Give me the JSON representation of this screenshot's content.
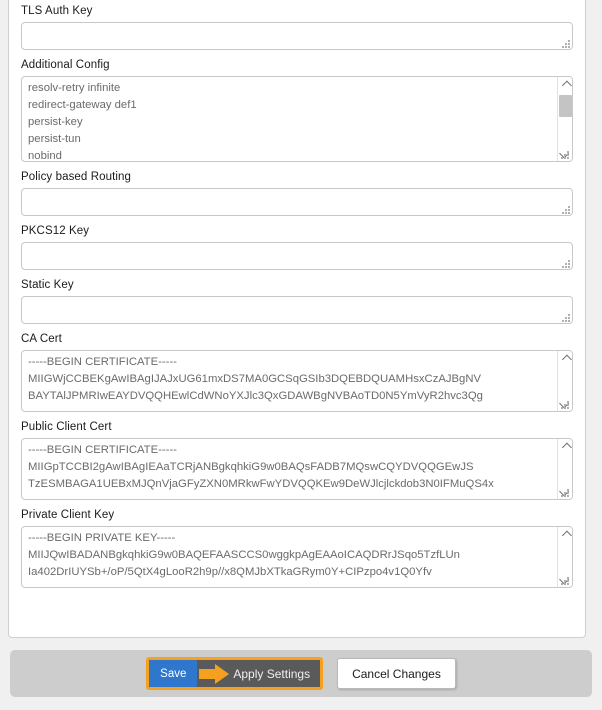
{
  "form": {
    "fields": [
      {
        "id": "tls-auth-key",
        "label": "TLS Auth Key",
        "type": "input",
        "value": "",
        "placeholder": ""
      },
      {
        "id": "additional-config",
        "label": "Additional Config",
        "type": "textarea",
        "value": "resolv-retry infinite\nredirect-gateway def1\npersist-key\npersist-tun\nnobind",
        "scrollbar": true
      },
      {
        "id": "policy-based-routing",
        "label": "Policy based Routing",
        "type": "input",
        "value": "",
        "placeholder": ""
      },
      {
        "id": "pkcs12-key",
        "label": "PKCS12 Key",
        "type": "input",
        "value": "",
        "placeholder": ""
      },
      {
        "id": "static-key",
        "label": "Static Key",
        "type": "input",
        "value": "",
        "placeholder": ""
      },
      {
        "id": "ca-cert",
        "label": "CA Cert",
        "type": "textarea",
        "value": "-----BEGIN CERTIFICATE-----\nMIIGWjCCBEKgAwIBAgIJAJxUG61mxDS7MA0GCSqGSIb3DQEBDQUAMHsxCzAJBgNV\nBAYTAlJPMRIwEAYDVQQHEwlCdWNoYXJlc3QxGDAWBgNVBAoTD0N5YmVyR2hvc3Qg",
        "scrollbar": true
      },
      {
        "id": "public-client-cert",
        "label": "Public Client Cert",
        "type": "textarea",
        "value": "-----BEGIN CERTIFICATE-----\nMIIGpTCCBI2gAwIBAgIEAaTCRjANBgkqhkiG9w0BAQsFADB7MQswCQYDVQQGEwJS\nTzESMBAGA1UEBxMJQnVjaGFyZXN0MRkwFwYDVQQKEw9DeWJlcjlckdob3N0IFMuQS4x",
        "scrollbar": true
      },
      {
        "id": "private-client-key",
        "label": "Private Client Key",
        "type": "textarea",
        "value": "-----BEGIN PRIVATE KEY-----\nMIIJQwIBADANBgkqhkiG9w0BAQEFAASCCS0wggkpAgEAAoICAQDRrJSqo5TzfLUn\nIa402DrIUYSb+/oP/5QtX4gLooR2h9p//x8QMJbXTkaGRym0Y+CIPzpo4v1Q0Yfv",
        "scrollbar": true
      }
    ]
  },
  "footer": {
    "save_label": "Save",
    "apply_label": "Apply Settings",
    "cancel_label": "Cancel Changes",
    "highlight_color": "#f5a01e",
    "save_color": "#2f77cc",
    "callout_bg": "#5a5a5a",
    "bar_color": "#cdcdcd"
  }
}
